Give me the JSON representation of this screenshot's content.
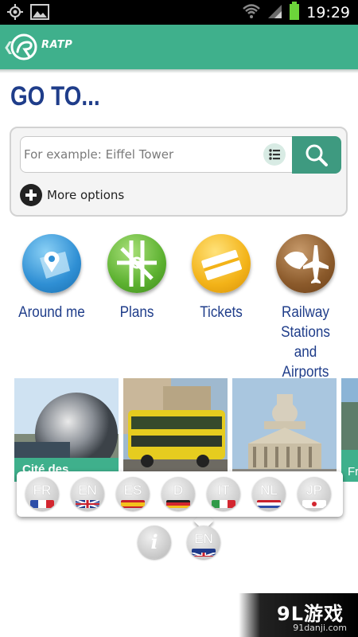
{
  "status_bar": {
    "time": "19:29",
    "left_icons": [
      "gps-icon",
      "image-icon"
    ],
    "right_icons": [
      "wifi-icon",
      "signal-icon",
      "battery-icon"
    ]
  },
  "app_bar": {
    "back_glyph": "❮",
    "brand": "RATP",
    "color": "#3fb08c"
  },
  "page": {
    "title": "GO TO..."
  },
  "search": {
    "placeholder": "For example: Eiffel Tower",
    "more_options_label": "More options"
  },
  "quick_nav": [
    {
      "label": "Around me",
      "icon": "location-pin-icon",
      "color": "#2f8fd4"
    },
    {
      "label": "Plans",
      "icon": "map-plan-icon",
      "color": "#5cb130"
    },
    {
      "label": "Tickets",
      "icon": "tickets-icon",
      "color": "#f3b318"
    },
    {
      "label": "Railway Stations and Airports",
      "icon": "train-plane-icon",
      "color": "#8b5a2b"
    }
  ],
  "photos": [
    {
      "caption": "Cité des",
      "subject": "geode-sphere"
    },
    {
      "caption": "",
      "subject": "open-tour-bus"
    },
    {
      "caption": "",
      "subject": "pantheon"
    },
    {
      "caption": "Fr M",
      "subject": "riverside"
    }
  ],
  "languages": [
    {
      "code": "FR",
      "flag": [
        "#2d4ea8",
        "#ffffff",
        "#d3262f"
      ]
    },
    {
      "code": "EN",
      "flag": [
        "#1f3a8a",
        "#ffffff",
        "#c8202c"
      ]
    },
    {
      "code": "ES",
      "flag": [
        "#c8202c",
        "#f3c11c",
        "#c8202c"
      ]
    },
    {
      "code": "D",
      "flag": [
        "#222222",
        "#d3262f",
        "#f3c11c"
      ]
    },
    {
      "code": "IT",
      "flag": [
        "#2f9a48",
        "#ffffff",
        "#d3262f"
      ]
    },
    {
      "code": "NL",
      "flag": [
        "#c8202c",
        "#ffffff",
        "#2d4ea8"
      ]
    },
    {
      "code": "JP",
      "flag": [
        "#ffffff",
        "#d3262f",
        "#ffffff"
      ]
    }
  ],
  "current_language": {
    "code": "EN"
  },
  "info_glyph": "i",
  "watermark": {
    "logo": "9L游戏",
    "url": "91danji.com"
  }
}
